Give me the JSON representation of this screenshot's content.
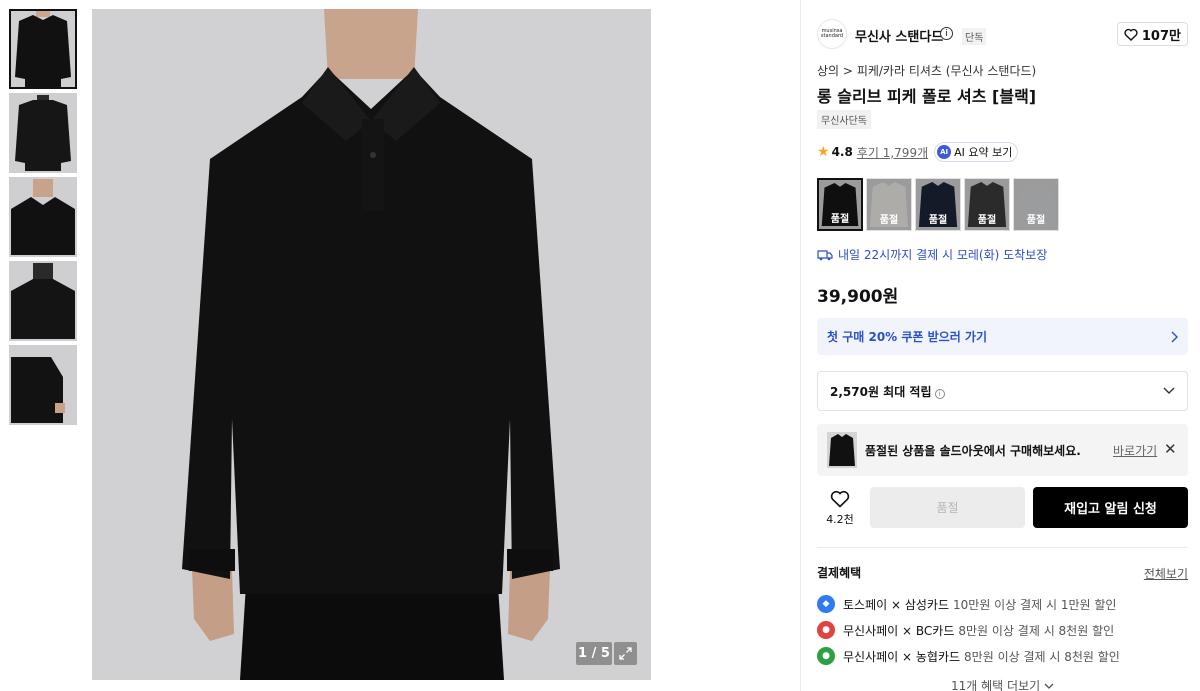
{
  "gallery": {
    "counter": "1 / 5",
    "thumbnails": [
      "front",
      "back",
      "detail",
      "back-detail",
      "side"
    ]
  },
  "brand": {
    "logo_text_1": "musinsa",
    "logo_text_2": "standard",
    "name": "무신사 스탠다드",
    "badge": "단독",
    "likes": "107만"
  },
  "breadcrumb": {
    "category": "상의",
    "separator": ">",
    "subcategory": "피케/카라 티셔츠 (무신사 스탠다드)"
  },
  "product": {
    "title": "롱 슬리브 피케 폴로 셔츠 [블랙]",
    "tag": "무신사단독",
    "rating": "4.8",
    "reviews": "후기 1,799개",
    "ai_label": "AI 요약 보기",
    "ai_badge": "AI",
    "price": "39,900원"
  },
  "colors": [
    {
      "label": "품절",
      "tone": "#151515"
    },
    {
      "label": "품절",
      "tone": "#e9e6e0"
    },
    {
      "label": "품절",
      "tone": "#1c2336"
    },
    {
      "label": "품절",
      "tone": "#3a3a3a"
    },
    {
      "label": "품절",
      "tone": "#cfd0d2"
    }
  ],
  "delivery": "내일 22시까지 결제 시 모레(화) 도착보장",
  "coupon": "첫 구매 20% 쿠폰 받으러 가기",
  "points": "2,570원 최대 적립",
  "soldout": {
    "message": "품절된 상품을 솔드아웃에서 구매해보세요.",
    "link": "바로가기"
  },
  "actions": {
    "wish_count": "4.2천",
    "soldout_label": "품절",
    "restock_label": "재입고 알림 신청"
  },
  "benefits": {
    "title": "결제혜택",
    "view_all": "전체보기",
    "items": [
      {
        "name": "토스페이 × 삼성카드",
        "desc": "10만원 이상 결제 시 1만원 할인",
        "color": "#2d7cf6"
      },
      {
        "name": "무신사페이 × BC카드",
        "desc": "8만원 이상 결제 시 8천원 할인",
        "color": "#e0443e"
      },
      {
        "name": "무신사페이 × 농협카드",
        "desc": "8만원 이상 결제 시 8천원 할인",
        "color": "#2ea043"
      }
    ],
    "more": "11개 혜택 더보기"
  },
  "accent": "#2b50c8"
}
